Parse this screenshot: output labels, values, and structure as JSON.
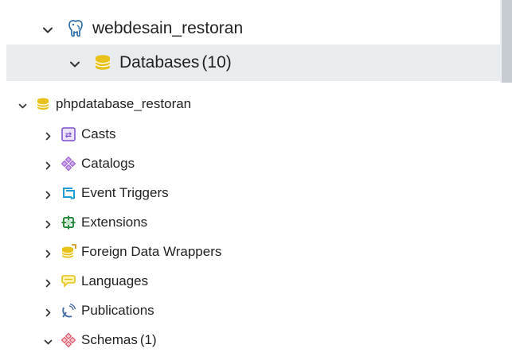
{
  "top_panel": {
    "server_label": "webdesain_restoran",
    "databases_label": "Databases",
    "databases_count": "(10)"
  },
  "tree": {
    "database_label": "phpdatabase_restoran",
    "items": [
      {
        "label": "Casts",
        "icon": "casts-icon",
        "expanded": false
      },
      {
        "label": "Catalogs",
        "icon": "catalogs-icon",
        "expanded": false
      },
      {
        "label": "Event Triggers",
        "icon": "event-triggers-icon",
        "expanded": false
      },
      {
        "label": "Extensions",
        "icon": "extensions-icon",
        "expanded": false
      },
      {
        "label": "Foreign Data Wrappers",
        "icon": "foreign-data-wrappers-icon",
        "expanded": false
      },
      {
        "label": "Languages",
        "icon": "languages-icon",
        "expanded": false
      },
      {
        "label": "Publications",
        "icon": "publications-icon",
        "expanded": false
      },
      {
        "label": "Schemas",
        "count": "(1)",
        "icon": "schemas-icon",
        "expanded": true
      }
    ]
  },
  "colors": {
    "selected_row_bg": "#e9ecef",
    "text": "#222222",
    "database_yellow": "#e8c21a",
    "schema_red": "#d9465a",
    "catalog_purple": "#9b59d0",
    "trigger_blue": "#1f9bd6",
    "extension_green": "#2e8b3d"
  }
}
